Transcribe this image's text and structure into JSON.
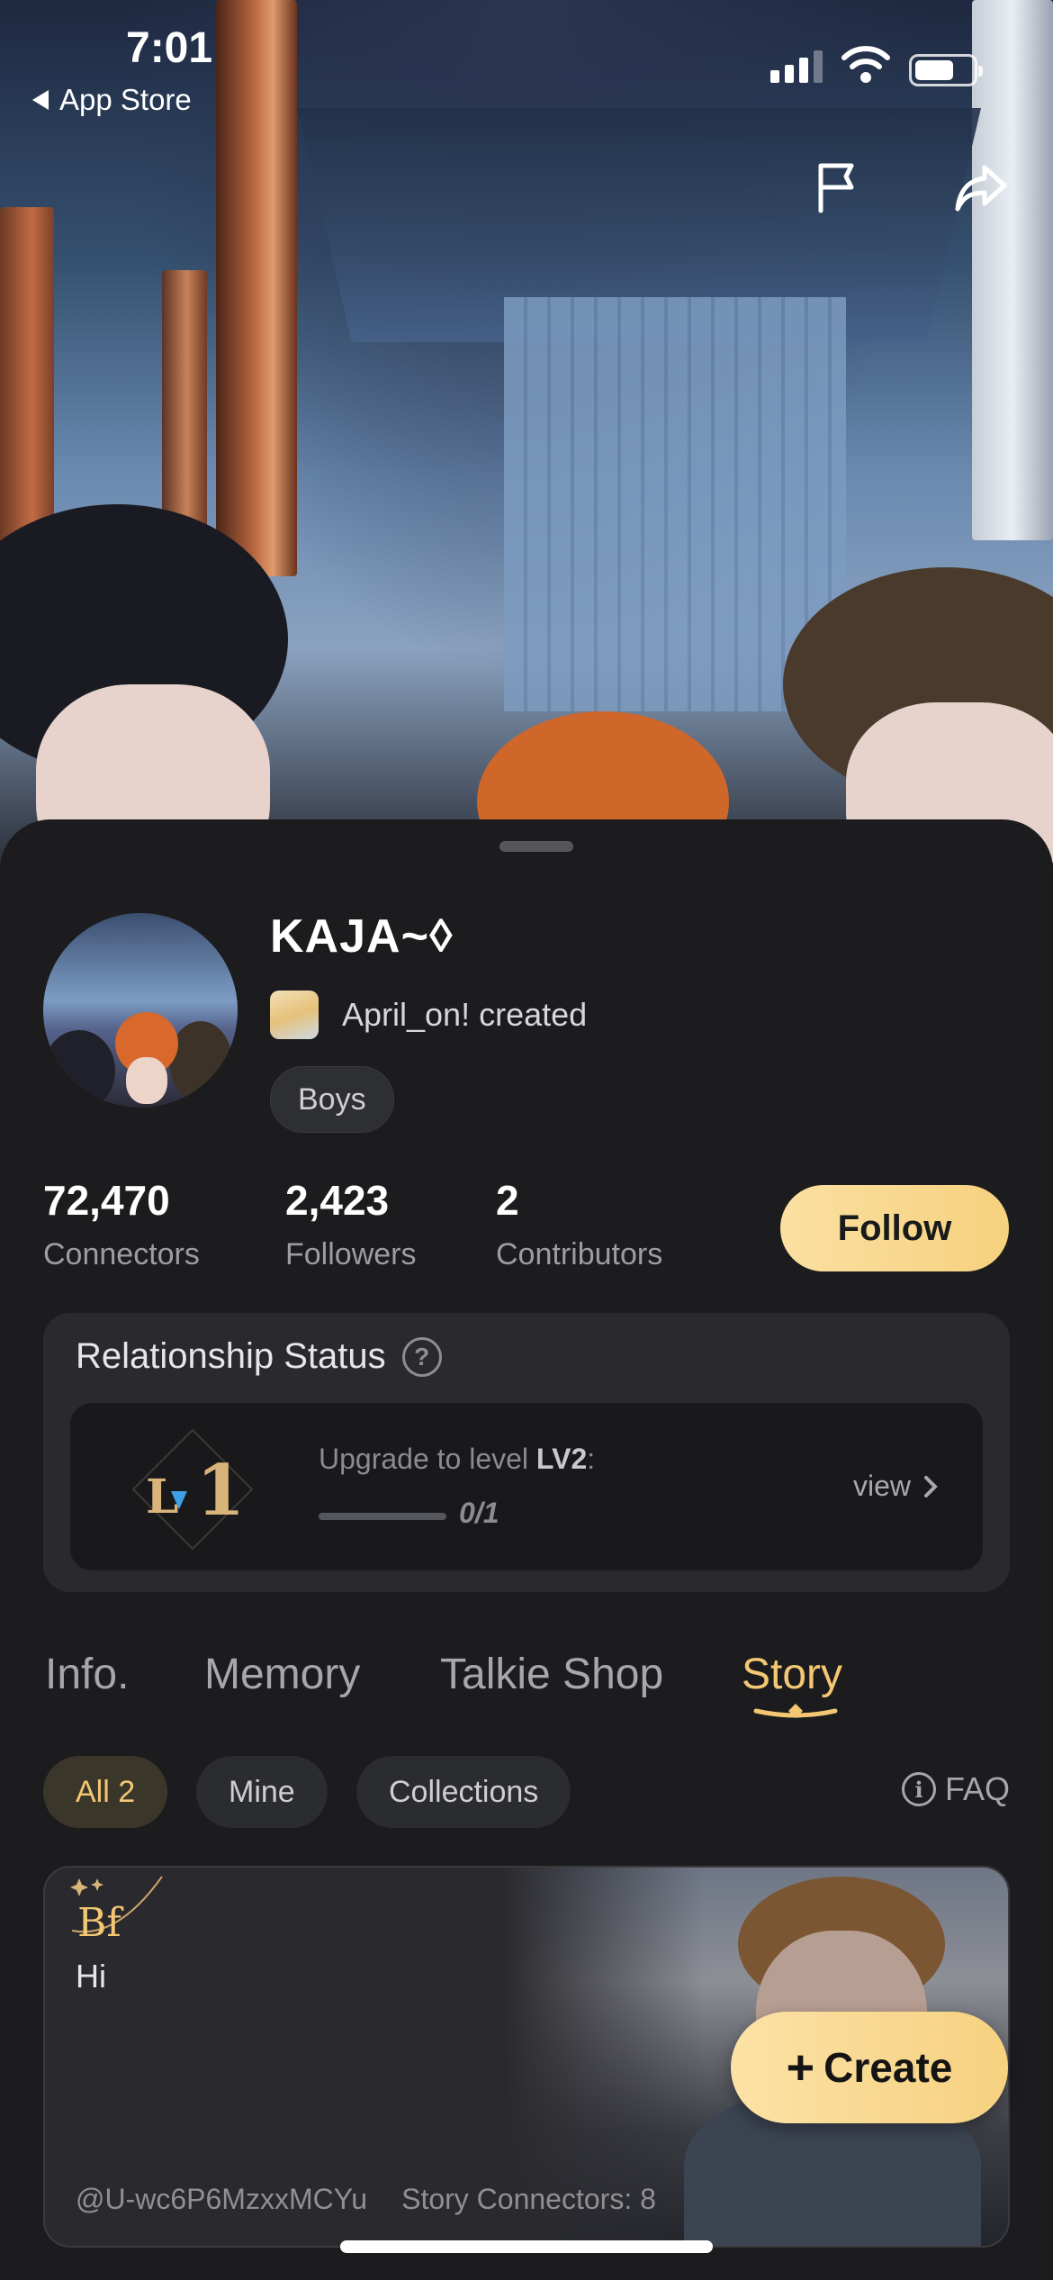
{
  "status_bar": {
    "time": "7:01",
    "back_app": "App Store",
    "signal_bars": 4,
    "battery_level": 0.65
  },
  "hero": {
    "report_icon": "flag-icon",
    "share_icon": "share-icon"
  },
  "profile": {
    "name": "KAJA~◊",
    "creator": "April_on! created",
    "tag": "Boys"
  },
  "stats": [
    {
      "value": "72,470",
      "label": "Connectors"
    },
    {
      "value": "2,423",
      "label": "Followers"
    },
    {
      "value": "2",
      "label": "Contributors"
    }
  ],
  "follow_label": "Follow",
  "relationship": {
    "title": "Relationship Status",
    "level_badge": "Lv1",
    "upgrade_prefix": "Upgrade to level ",
    "upgrade_level": "LV2",
    "upgrade_suffix": ":",
    "progress_current": 0,
    "progress_total": 1,
    "progress_text": "0/1",
    "view_label": "view"
  },
  "tabs": [
    {
      "label": "Info.",
      "active": false
    },
    {
      "label": "Memory",
      "active": false
    },
    {
      "label": "Talkie Shop",
      "active": false
    },
    {
      "label": "Story",
      "active": true
    }
  ],
  "filters": [
    {
      "label": "All 2",
      "active": true
    },
    {
      "label": "Mine",
      "active": false
    },
    {
      "label": "Collections",
      "active": false
    }
  ],
  "faq_label": "FAQ",
  "story_card": {
    "logo_text": "Bf",
    "text": "Hi",
    "author": "@U-wc6P6MzxxMCYu",
    "connectors": "Story Connectors: 8"
  },
  "create_label": "Create",
  "colors": {
    "accent": "#F3C773",
    "button_gradient_start": "#FBE0A2",
    "button_gradient_end": "#F6D17E",
    "sheet_background": "#1C1C1F",
    "card_background": "#2A2A2E"
  }
}
